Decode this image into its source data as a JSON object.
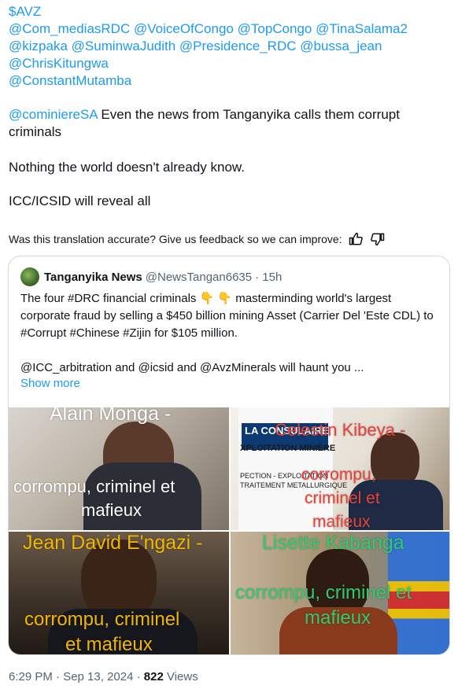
{
  "tweet": {
    "cashtag": "$AVZ",
    "mentions": [
      "@Com_mediasRDC",
      "@VoiceOfCongo",
      "@TopCongo",
      "@TinaSalama2",
      "@kizpaka",
      "@SuminwaJudith",
      "@Presidence_RDC",
      "@bussa_jean",
      "@ChrisKitungwa",
      "@ConstantMutamba"
    ],
    "reply_mention": "@cominiereSA",
    "line1_rest": " Even the news from Tanganyika calls them corrupt criminals",
    "line2": "Nothing the world doesn't already know.",
    "line3": "ICC/ICSID will reveal all",
    "feedback_prompt": "Was this translation accurate? Give us feedback so we can improve:",
    "time": "6:29 PM · Sep 13, 2024 · ",
    "views_count": "822",
    "views_label": " Views"
  },
  "quote": {
    "name": "Tanganyika News",
    "handle": "@NewsTangan6635",
    "time": "· 15h",
    "text1": "The four #DRC financial criminals 👇 👇  masterminding world's largest corporate fraud by selling a $450 billion mining Asset (Carrier Del 'Este CDL) to #Corrupt #Chinese #Zijin for $105 million.",
    "text2": "@ICC_arbitration and @icsid and @AvzMinerals will haunt you ...",
    "show_more": "Show more"
  },
  "images": [
    {
      "name_text": "Alain Monga -",
      "caption": "corrompu, criminel et",
      "caption2": "mafieux",
      "name_color": "#ffffff",
      "caption_color": "#ffffff"
    },
    {
      "name_text": "Celestin Kibeya -",
      "caption": "corrompu,",
      "caption2": "criminel et",
      "caption3": "mafieux",
      "sign1": "LA CONSULAIRE",
      "sign2": "XPLOITATION MINIÈRE",
      "sign3": "PECTION - EXPLOITATION",
      "sign4": "TRAITEMENT METALLURGIQUE",
      "name_color": "#e8443a",
      "caption_color": "#e8443a"
    },
    {
      "name_text": "Jean David E'ngazi -",
      "caption": "corrompu, criminel",
      "caption2": "et mafieux",
      "name_color": "#f2b600",
      "caption_color": "#f2b600"
    },
    {
      "name_text": "Lisette Kabanga",
      "caption": "corrompu, criminel et",
      "caption2": "mafieux",
      "name_color": "#2ecc71",
      "caption_color": "#2ecc71"
    }
  ]
}
